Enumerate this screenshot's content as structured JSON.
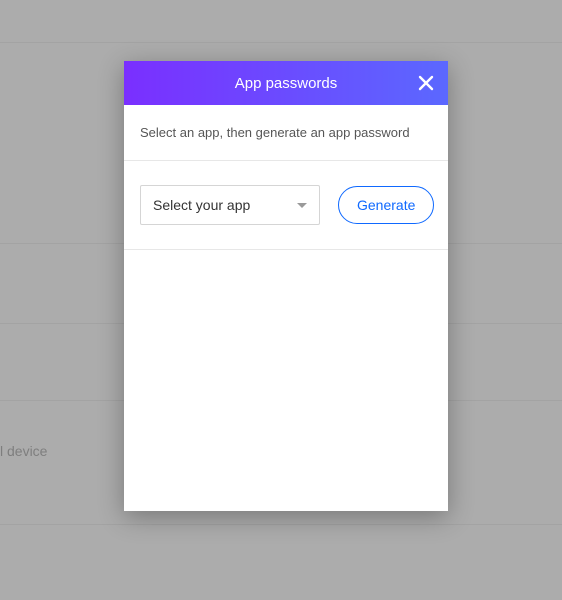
{
  "modal": {
    "title": "App passwords",
    "instruction": "Select an app, then generate an app password",
    "select": {
      "label": "Select your app"
    },
    "generate_label": "Generate"
  },
  "background": {
    "device_text": "l device"
  }
}
